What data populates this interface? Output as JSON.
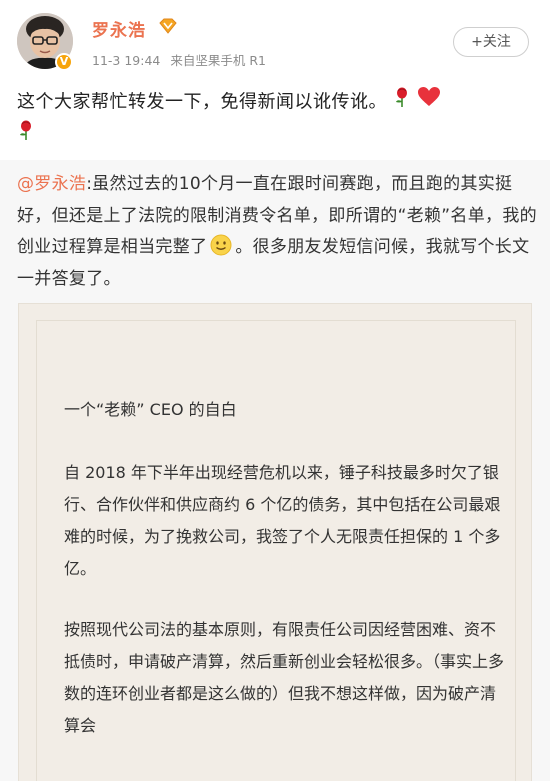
{
  "header": {
    "user_name": "罗永浩",
    "timestamp": "11-3 19:44",
    "source": "来自坚果手机 R1",
    "follow_label": "+关注"
  },
  "post": {
    "text": "这个大家帮忙转发一下，免得新闻以讹传讹。"
  },
  "repost": {
    "mention": "@罗永浩",
    "text_before_emoji": ":虽然过去的10个月一直在跟时间赛跑，而且跑的其实挺好，但还是上了法院的限制消费令名单，即所谓的“老赖”名单，我的创业过程算是相当完整了",
    "text_after_emoji": "。很多朋友发短信问候，我就写个长文一并答复了。"
  },
  "letter": {
    "title": "一个“老赖” CEO 的自白",
    "paragraph1": "自 2018 年下半年出现经营危机以来，锤子科技最多时欠了银行、合作伙伴和供应商约 6 个亿的债务，其中包括在公司最艰难的时候，为了挽救公司，我签了个人无限责任担保的 1 个多亿。",
    "paragraph2": "按照现代公司法的基本原则，有限责任公司因经营困难、资不抵债时，申请破产清算，然后重新创业会轻松很多。（事实上多数的连环创业者都是这么做的）但我不想这样做，因为破产清算会"
  },
  "colors": {
    "name_orange": "#eb7350",
    "mention_orange": "#eb7350",
    "repost_background": "#f7f7f7",
    "letter_background": "#f2ede6"
  },
  "icons": [
    "avatar",
    "verified-badge-icon",
    "vip-badge-icon",
    "rose-icon",
    "heart-icon",
    "smile-emoji-icon"
  ]
}
